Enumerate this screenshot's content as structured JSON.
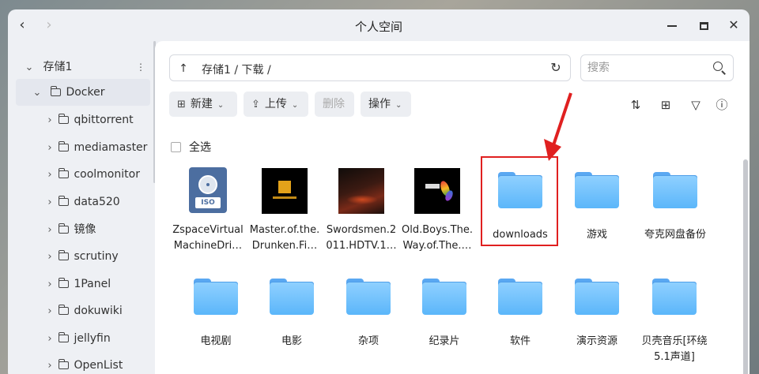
{
  "window": {
    "title": "个人空间",
    "back_glyph": "‹",
    "forward_glyph": "›",
    "minimize_icon": "minimize-icon",
    "maximize_icon": "maximize-icon",
    "close_glyph": "✕"
  },
  "sidebar": {
    "root": {
      "label": "存储1",
      "more_glyph": "⋮"
    },
    "docker": {
      "label": "Docker"
    },
    "items": [
      {
        "label": "qbittorrent"
      },
      {
        "label": "mediamaster"
      },
      {
        "label": "coolmonitor"
      },
      {
        "label": "data520"
      },
      {
        "label": "镜像"
      },
      {
        "label": "scrutiny"
      },
      {
        "label": "1Panel"
      },
      {
        "label": "dokuwiki"
      },
      {
        "label": "jellyfin"
      },
      {
        "label": "OpenList"
      }
    ]
  },
  "pathbar": {
    "path": "存储1 / 下载 /",
    "up_glyph": "↑",
    "refresh_glyph": "↻"
  },
  "search": {
    "placeholder": "搜索",
    "value": ""
  },
  "toolbar": {
    "new_label": "新建",
    "upload_label": "上传",
    "delete_label": "删除",
    "ops_label": "操作",
    "dropdown_glyph": "⌄",
    "new_icon_glyph": "⊞",
    "upload_icon_glyph": "⇪",
    "sort_glyph": "⇅",
    "grid_glyph": "⊞",
    "filter_glyph": "▽",
    "info_glyph": "ⓘ"
  },
  "selection": {
    "select_all_label": "全选"
  },
  "files": [
    {
      "name": "ZspaceVirtualMachineDri…",
      "line1": "ZspaceVirtual",
      "line2": "MachineDri…",
      "kind": "iso",
      "badge": "ISO"
    },
    {
      "name": "Master.of.the.Drunken.Fi…",
      "line1": "Master.of.the.",
      "line2": "Drunken.Fi…",
      "kind": "video"
    },
    {
      "name": "Swordsmen.2011.HDTV.1…",
      "line1": "Swordsmen.2",
      "line2": "011.HDTV.1…",
      "kind": "video"
    },
    {
      "name": "Old.Boys.The.Way.of.The.…",
      "line1": "Old.Boys.The.",
      "line2": "Way.of.The.…",
      "kind": "video"
    },
    {
      "name": "downloads",
      "kind": "folder"
    },
    {
      "name": "游戏",
      "kind": "folder"
    },
    {
      "name": "夸克网盘备份",
      "kind": "folder"
    },
    {
      "name": "电视剧",
      "kind": "folder"
    },
    {
      "name": "电影",
      "kind": "folder"
    },
    {
      "name": "杂项",
      "kind": "folder"
    },
    {
      "name": "纪录片",
      "kind": "folder"
    },
    {
      "name": "软件",
      "kind": "folder"
    },
    {
      "name": "演示资源",
      "kind": "folder"
    },
    {
      "name": "贝壳音乐[环绕5.1声道]",
      "line1": "贝壳音乐[环绕",
      "line2": "5.1声道]",
      "kind": "folder"
    }
  ],
  "annotation": {
    "color": "#e02020",
    "target": "downloads"
  }
}
